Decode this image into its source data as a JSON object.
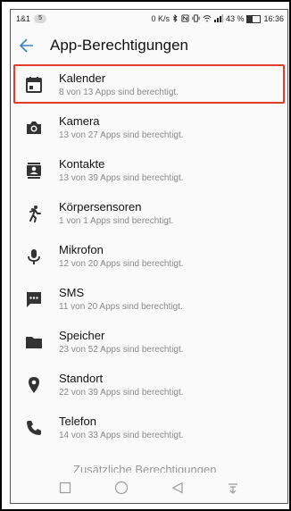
{
  "status": {
    "left_text": "1&1",
    "badge": "5",
    "speed": "0 K/s",
    "battery": "43 %",
    "battery_level": 0.43,
    "time": "16:36"
  },
  "appbar": {
    "title": "App-Berechtigungen"
  },
  "permissions": [
    {
      "name": "Kalender",
      "desc": "8 von 13 Apps sind berechtigt.",
      "icon": "calendar-icon"
    },
    {
      "name": "Kamera",
      "desc": "13 von 27 Apps sind berechtigt.",
      "icon": "camera-icon"
    },
    {
      "name": "Kontakte",
      "desc": "13 von 39 Apps sind berechtigt.",
      "icon": "contacts-icon"
    },
    {
      "name": "Körpersensoren",
      "desc": "1 von 1 Apps sind berechtigt.",
      "icon": "body-sensors-icon"
    },
    {
      "name": "Mikrofon",
      "desc": "12 von 20 Apps sind berechtigt.",
      "icon": "microphone-icon"
    },
    {
      "name": "SMS",
      "desc": "11 von 20 Apps sind berechtigt.",
      "icon": "sms-icon"
    },
    {
      "name": "Speicher",
      "desc": "23 von 52 Apps sind berechtigt.",
      "icon": "folder-icon"
    },
    {
      "name": "Standort",
      "desc": "22 von 39 Apps sind berechtigt.",
      "icon": "location-icon"
    },
    {
      "name": "Telefon",
      "desc": "14 von 33 Apps sind berechtigt.",
      "icon": "phone-icon"
    }
  ],
  "partial_item": "Zusätzliche Berechtigungen"
}
